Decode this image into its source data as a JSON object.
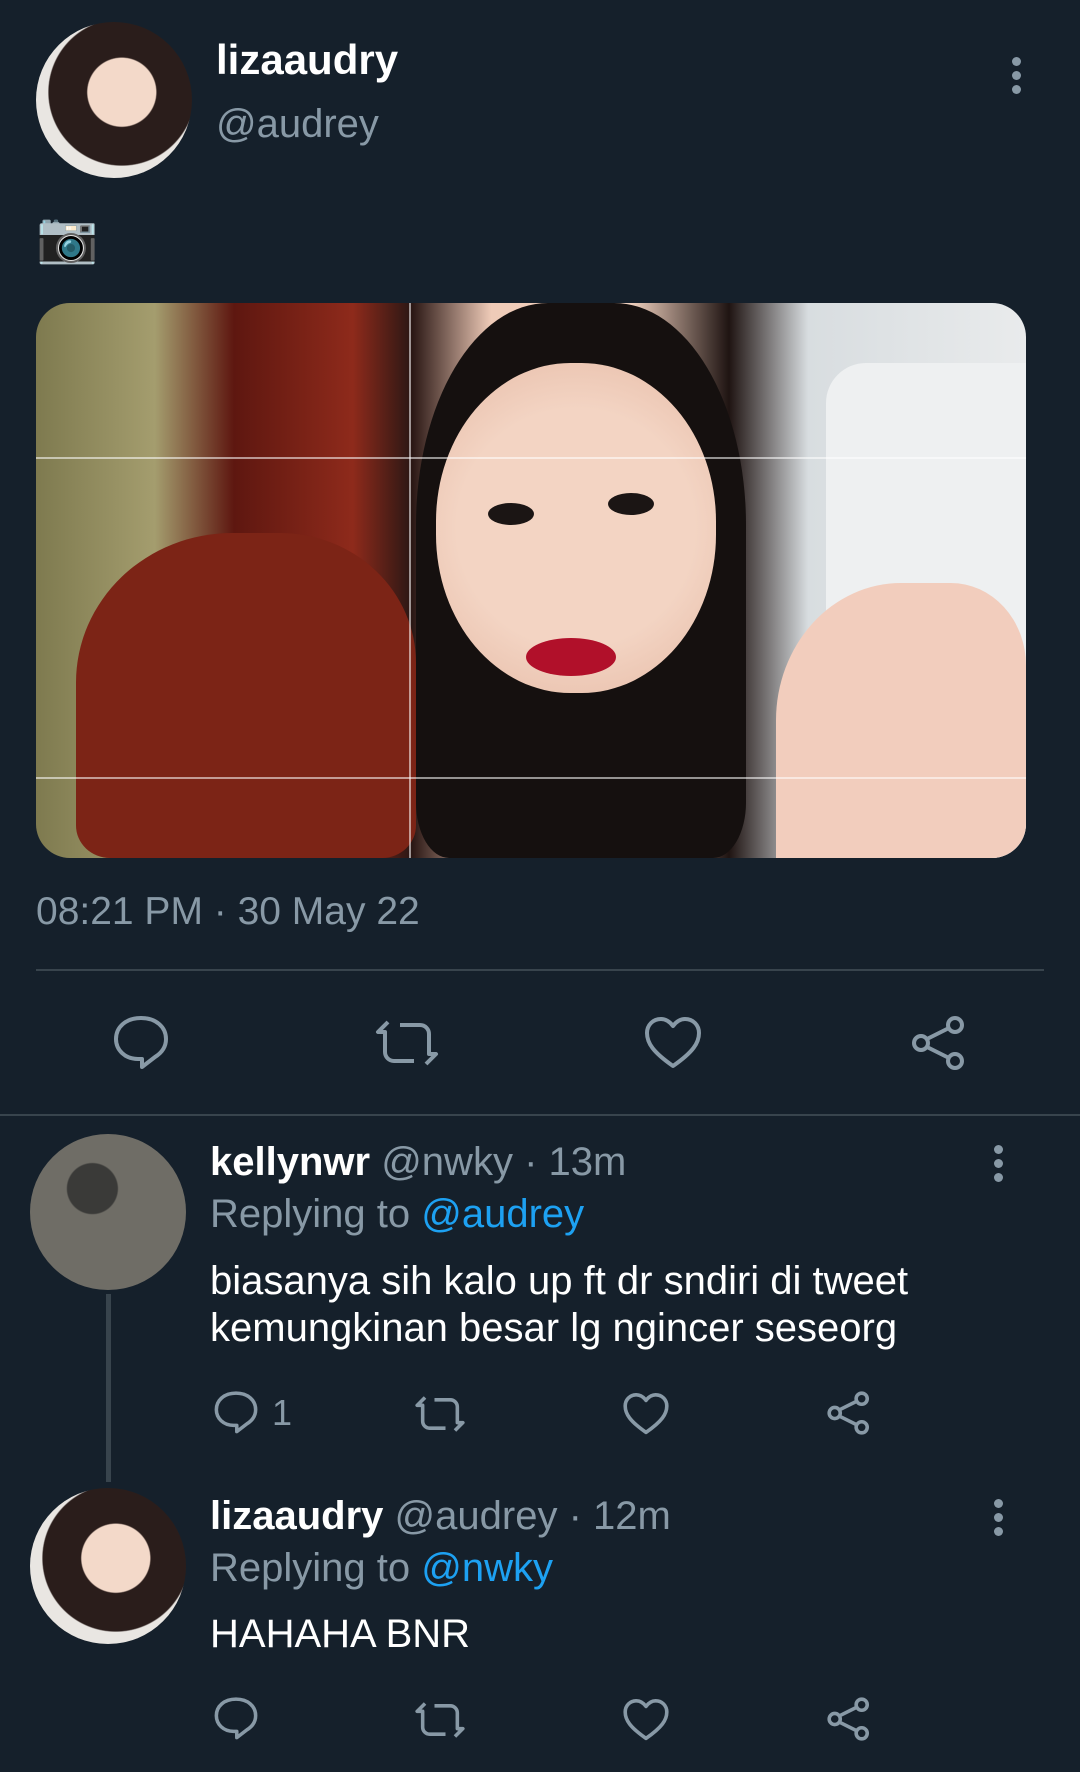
{
  "main_tweet": {
    "display_name": "lizaaudry",
    "handle": "@audrey",
    "text": "📷",
    "timestamp": "08:21 PM · 30 May 22",
    "actions": [
      "reply-icon",
      "retweet-icon",
      "like-icon",
      "share-icon"
    ]
  },
  "replies": [
    {
      "display_name": "kellynwr",
      "handle": "@nwky",
      "time": "· 13m",
      "replying_prefix": "Replying to",
      "replying_to": "@audrey",
      "text_line1": "biasanya sih kalo up ft dr sndiri di tweet",
      "text_line2": "kemungkinan besar lg ngincer seseorg",
      "reply_count": "1"
    },
    {
      "display_name": "lizaaudry",
      "handle": "@audrey",
      "time": "· 12m",
      "replying_prefix": "Replying to",
      "replying_to": "@nwky",
      "text": "HAHAHA BNR",
      "reply_count": ""
    }
  ],
  "colors": {
    "background": "#15202b",
    "muted": "#8899a6",
    "accent": "#1da1f2",
    "divider": "#38444d"
  }
}
